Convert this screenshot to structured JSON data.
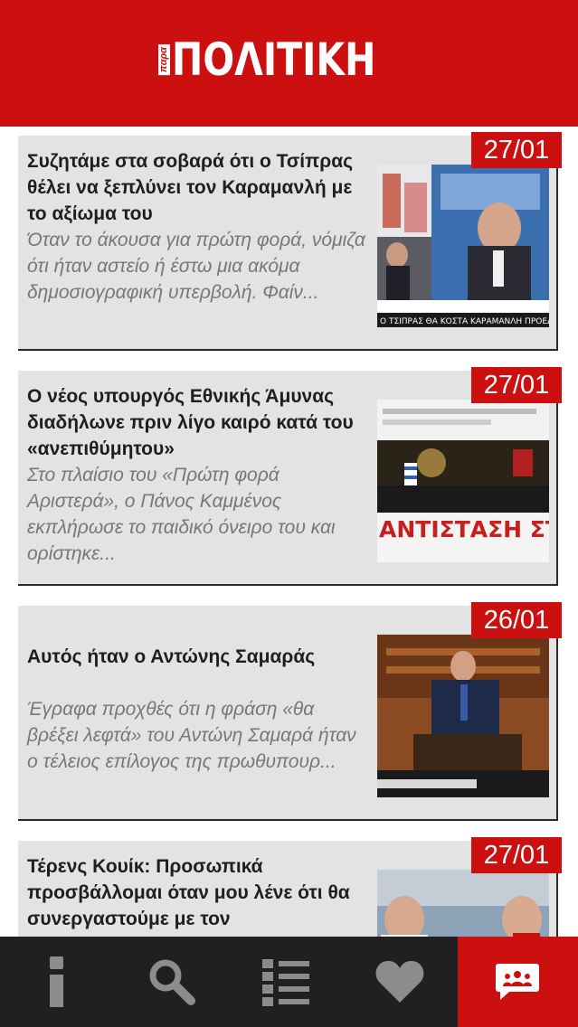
{
  "header": {
    "logo_small": "παρα",
    "logo_main": "ΠΟΛΙΤΙΚΗ"
  },
  "articles": [
    {
      "title": "Συζητάμε στα σοβαρά ότι ο Τσίπρας θέλει να ξεπλύνει τον Καραμανλή με το αξίωμα του",
      "excerpt": "Όταν το άκουσα για πρώτη φορά, νόμιζα ότι ήταν αστείο ή έστω μια ακόμα δημοσιογραφική υπερβολή. Φαίν...",
      "date": "27/01",
      "thumb_caption": "Ο ΤΣΙΠΡΑΣ ΘΑ ΚΟΣΤΑ ΚΑΡΑΜΑΝΛΗ ΠΡΟΕΔΡΟ ΔΗΜΟΚ"
    },
    {
      "title": "Ο νέος υπουργός Εθνικής Άμυνας διαδήλωνε πριν λίγο καιρό κατά του «ανεπιθύμητου»",
      "excerpt": "Στο πλαίσιο του «Πρώτη φορά Αριστερά», ο Πάνος Καμμένος εκπλήρωσε το παιδικό όνειρο του και ορίστηκε...",
      "date": "27/01",
      "thumb_caption": "ΑΝΤΙΣΤΑΣΗ ΣΤΟΝ ΣΙΩΝΙΣΜΟ"
    },
    {
      "title": "Αυτός ήταν ο Αντώνης Σαμαράς",
      "excerpt": "Έγραφα προχθές ότι η φράση «θα βρέξει λεφτά» του Αντώνη Σαμαρά ήταν ο τέλειος επίλογος της πρωθυπουρ...",
      "date": "26/01",
      "thumb_caption": ""
    },
    {
      "title": "Τέρενς Κουίκ: Προσωπικά προσβάλλομαι όταν μου λένε ότι θα συνεργαστούμε με τον",
      "excerpt": "",
      "date": "27/01",
      "thumb_caption": ""
    }
  ],
  "tabbar": {
    "tabs": [
      {
        "icon": "info-icon",
        "active": false
      },
      {
        "icon": "search-icon",
        "active": false
      },
      {
        "icon": "list-icon",
        "active": false
      },
      {
        "icon": "heart-icon",
        "active": false
      },
      {
        "icon": "people-chat-icon",
        "active": true
      }
    ]
  },
  "colors": {
    "brand_red": "#cc1010",
    "tabbar_bg": "#202020",
    "card_bg": "#e3e3e3"
  }
}
